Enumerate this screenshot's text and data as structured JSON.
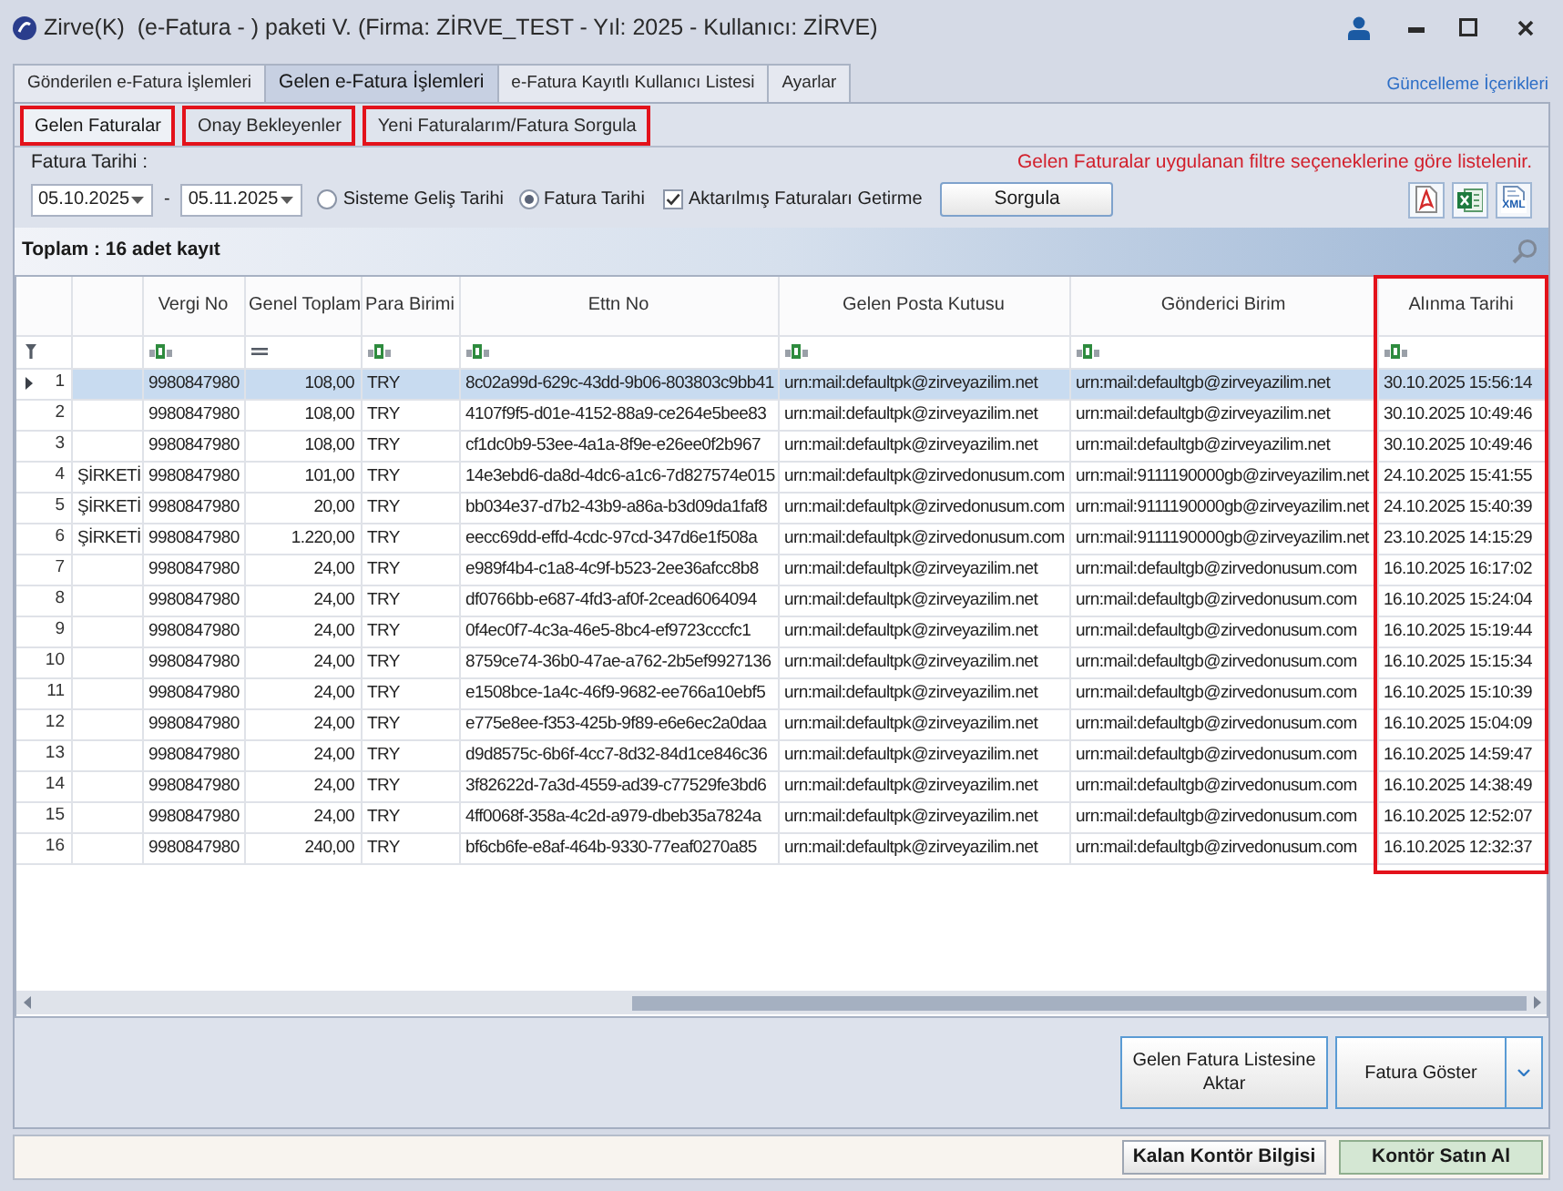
{
  "window": {
    "title": "Zirve(K)  (e-Fatura - ) paketi V. (Firma: ZİRVE_TEST - Yıl: 2025 - Kullanıcı: ZİRVE)"
  },
  "main_tabs": [
    {
      "label": "Gönderilen e-Fatura İşlemleri",
      "selected": false
    },
    {
      "label": "Gelen e-Fatura İşlemleri",
      "selected": true
    },
    {
      "label": "e-Fatura Kayıtlı Kullanıcı Listesi",
      "selected": false
    },
    {
      "label": "Ayarlar",
      "selected": false
    }
  ],
  "update_link": "Güncelleme İçerikleri",
  "sub_tabs": [
    {
      "label": "Gelen Faturalar",
      "selected": true,
      "highlighted": true
    },
    {
      "label": "Onay Bekleyenler",
      "selected": false,
      "highlighted": true
    },
    {
      "label": "Yeni Faturalarım/Fatura Sorgula",
      "selected": false,
      "highlighted": true
    }
  ],
  "filter": {
    "label": "Fatura Tarihi :",
    "info": "Gelen Faturalar uygulanan filtre seçeneklerine göre listelenir.",
    "date_from": "05.10.2025",
    "separator": "-",
    "date_to": "05.11.2025",
    "date_options": [
      {
        "label": "Sisteme Geliş Tarihi",
        "selected": false
      },
      {
        "label": "Fatura Tarihi",
        "selected": true
      }
    ],
    "exclude_transferred": {
      "label": "Aktarılmış Faturaları Getirme",
      "checked": true
    },
    "query_button": "Sorgula",
    "export_buttons": [
      {
        "kind": "pdf"
      },
      {
        "kind": "excel"
      },
      {
        "kind": "xml",
        "label": "XML"
      }
    ]
  },
  "summary": "Toplam : 16 adet kayıt",
  "table": {
    "columns": [
      {
        "kind": "text",
        "filterable": false,
        "highlighted": false
      },
      {
        "label": "Vergi No",
        "kind": "text",
        "filterable": true,
        "highlighted": false
      },
      {
        "label": "Genel Toplam",
        "kind": "number",
        "filterable": true,
        "highlighted": false
      },
      {
        "label": "Para Birimi",
        "kind": "text",
        "filterable": true,
        "highlighted": false
      },
      {
        "label": "Ettn No",
        "kind": "text",
        "filterable": true,
        "highlighted": false
      },
      {
        "label": "Gelen Posta Kutusu",
        "kind": "text",
        "filterable": true,
        "highlighted": false
      },
      {
        "label": "Gönderici Birim",
        "kind": "text",
        "filterable": true,
        "highlighted": false
      },
      {
        "label": "Alınma Tarihi",
        "kind": "text",
        "filterable": true,
        "highlighted": true
      }
    ],
    "rows": [
      {
        "number": "1",
        "selected": true,
        "vergi_no": "9980847980",
        "genel_toplam": "108,00",
        "para_birimi": "TRY",
        "ettn_no": "8c02a99d-629c-43dd-9b06-803803c9bb41",
        "gelen_posta_kutusu": "urn:mail:defaultpk@zirveyazilim.net",
        "gonderici_birim": "urn:mail:defaultgb@zirveyazilim.net",
        "alinma_tarihi": "30.10.2025 15:56:14"
      },
      {
        "number": "2",
        "selected": false,
        "vergi_no": "9980847980",
        "genel_toplam": "108,00",
        "para_birimi": "TRY",
        "ettn_no": "4107f9f5-d01e-4152-88a9-ce264e5bee83",
        "gelen_posta_kutusu": "urn:mail:defaultpk@zirveyazilim.net",
        "gonderici_birim": "urn:mail:defaultgb@zirveyazilim.net",
        "alinma_tarihi": "30.10.2025 10:49:46"
      },
      {
        "number": "3",
        "selected": false,
        "vergi_no": "9980847980",
        "genel_toplam": "108,00",
        "para_birimi": "TRY",
        "ettn_no": "cf1dc0b9-53ee-4a1a-8f9e-e26ee0f2b967",
        "gelen_posta_kutusu": "urn:mail:defaultpk@zirveyazilim.net",
        "gonderici_birim": "urn:mail:defaultgb@zirveyazilim.net",
        "alinma_tarihi": "30.10.2025 10:49:46"
      },
      {
        "number": "4",
        "selected": false,
        "column_1": "ŞİRKETİ",
        "vergi_no": "9980847980",
        "genel_toplam": "101,00",
        "para_birimi": "TRY",
        "ettn_no": "14e3ebd6-da8d-4dc6-a1c6-7d827574e015",
        "gelen_posta_kutusu": "urn:mail:defaultpk@zirvedonusum.com",
        "gonderici_birim": "urn:mail:9111190000gb@zirveyazilim.net",
        "alinma_tarihi": "24.10.2025 15:41:55"
      },
      {
        "number": "5",
        "selected": false,
        "column_1": "ŞİRKETİ",
        "vergi_no": "9980847980",
        "genel_toplam": "20,00",
        "para_birimi": "TRY",
        "ettn_no": "bb034e37-d7b2-43b9-a86a-b3d09da1faf8",
        "gelen_posta_kutusu": "urn:mail:defaultpk@zirvedonusum.com",
        "gonderici_birim": "urn:mail:9111190000gb@zirveyazilim.net",
        "alinma_tarihi": "24.10.2025 15:40:39"
      },
      {
        "number": "6",
        "selected": false,
        "column_1": "ŞİRKETİ",
        "vergi_no": "9980847980",
        "genel_toplam": "1.220,00",
        "para_birimi": "TRY",
        "ettn_no": "eecc69dd-effd-4cdc-97cd-347d6e1f508a",
        "gelen_posta_kutusu": "urn:mail:defaultpk@zirvedonusum.com",
        "gonderici_birim": "urn:mail:9111190000gb@zirveyazilim.net",
        "alinma_tarihi": "23.10.2025 14:15:29"
      },
      {
        "number": "7",
        "selected": false,
        "vergi_no": "9980847980",
        "genel_toplam": "24,00",
        "para_birimi": "TRY",
        "ettn_no": "e989f4b4-c1a8-4c9f-b523-2ee36afcc8b8",
        "gelen_posta_kutusu": "urn:mail:defaultpk@zirveyazilim.net",
        "gonderici_birim": "urn:mail:defaultgb@zirvedonusum.com",
        "alinma_tarihi": "16.10.2025 16:17:02"
      },
      {
        "number": "8",
        "selected": false,
        "vergi_no": "9980847980",
        "genel_toplam": "24,00",
        "para_birimi": "TRY",
        "ettn_no": "df0766bb-e687-4fd3-af0f-2cead6064094",
        "gelen_posta_kutusu": "urn:mail:defaultpk@zirveyazilim.net",
        "gonderici_birim": "urn:mail:defaultgb@zirvedonusum.com",
        "alinma_tarihi": "16.10.2025 15:24:04"
      },
      {
        "number": "9",
        "selected": false,
        "vergi_no": "9980847980",
        "genel_toplam": "24,00",
        "para_birimi": "TRY",
        "ettn_no": "0f4ec0f7-4c3a-46e5-8bc4-ef9723cccfc1",
        "gelen_posta_kutusu": "urn:mail:defaultpk@zirveyazilim.net",
        "gonderici_birim": "urn:mail:defaultgb@zirvedonusum.com",
        "alinma_tarihi": "16.10.2025 15:19:44"
      },
      {
        "number": "10",
        "selected": false,
        "vergi_no": "9980847980",
        "genel_toplam": "24,00",
        "para_birimi": "TRY",
        "ettn_no": "8759ce74-36b0-47ae-a762-2b5ef9927136",
        "gelen_posta_kutusu": "urn:mail:defaultpk@zirveyazilim.net",
        "gonderici_birim": "urn:mail:defaultgb@zirvedonusum.com",
        "alinma_tarihi": "16.10.2025 15:15:34"
      },
      {
        "number": "11",
        "selected": false,
        "vergi_no": "9980847980",
        "genel_toplam": "24,00",
        "para_birimi": "TRY",
        "ettn_no": "e1508bce-1a4c-46f9-9682-ee766a10ebf5",
        "gelen_posta_kutusu": "urn:mail:defaultpk@zirveyazilim.net",
        "gonderici_birim": "urn:mail:defaultgb@zirvedonusum.com",
        "alinma_tarihi": "16.10.2025 15:10:39"
      },
      {
        "number": "12",
        "selected": false,
        "vergi_no": "9980847980",
        "genel_toplam": "24,00",
        "para_birimi": "TRY",
        "ettn_no": "e775e8ee-f353-425b-9f89-e6e6ec2a0daa",
        "gelen_posta_kutusu": "urn:mail:defaultpk@zirveyazilim.net",
        "gonderici_birim": "urn:mail:defaultgb@zirvedonusum.com",
        "alinma_tarihi": "16.10.2025 15:04:09"
      },
      {
        "number": "13",
        "selected": false,
        "vergi_no": "9980847980",
        "genel_toplam": "24,00",
        "para_birimi": "TRY",
        "ettn_no": "d9d8575c-6b6f-4cc7-8d32-84d1ce846c36",
        "gelen_posta_kutusu": "urn:mail:defaultpk@zirveyazilim.net",
        "gonderici_birim": "urn:mail:defaultgb@zirvedonusum.com",
        "alinma_tarihi": "16.10.2025 14:59:47"
      },
      {
        "number": "14",
        "selected": false,
        "vergi_no": "9980847980",
        "genel_toplam": "24,00",
        "para_birimi": "TRY",
        "ettn_no": "3f82622d-7a3d-4559-ad39-c77529fe3bd6",
        "gelen_posta_kutusu": "urn:mail:defaultpk@zirveyazilim.net",
        "gonderici_birim": "urn:mail:defaultgb@zirvedonusum.com",
        "alinma_tarihi": "16.10.2025 14:38:49"
      },
      {
        "number": "15",
        "selected": false,
        "vergi_no": "9980847980",
        "genel_toplam": "24,00",
        "para_birimi": "TRY",
        "ettn_no": "4ff0068f-358a-4c2d-a979-dbeb35a7824a",
        "gelen_posta_kutusu": "urn:mail:defaultpk@zirveyazilim.net",
        "gonderici_birim": "urn:mail:defaultgb@zirvedonusum.com",
        "alinma_tarihi": "16.10.2025 12:52:07"
      },
      {
        "number": "16",
        "selected": false,
        "vergi_no": "9980847980",
        "genel_toplam": "240,00",
        "para_birimi": "TRY",
        "ettn_no": "bf6cb6fe-e8af-464b-9330-77eaf0270a85",
        "gelen_posta_kutusu": "urn:mail:defaultpk@zirveyazilim.net",
        "gonderici_birim": "urn:mail:defaultgb@zirvedonusum.com",
        "alinma_tarihi": "16.10.2025 12:32:37"
      }
    ]
  },
  "actions": [
    {
      "label": "Gelen Fatura Listesine Aktar",
      "kind": "button"
    },
    {
      "label": "Fatura Göster",
      "kind": "split"
    }
  ],
  "status_bar": {
    "buttons": [
      {
        "label": "Kalan Kontör Bilgisi",
        "kind": "normal"
      },
      {
        "label": "Kontör Satın Al",
        "kind": "buy"
      }
    ]
  }
}
